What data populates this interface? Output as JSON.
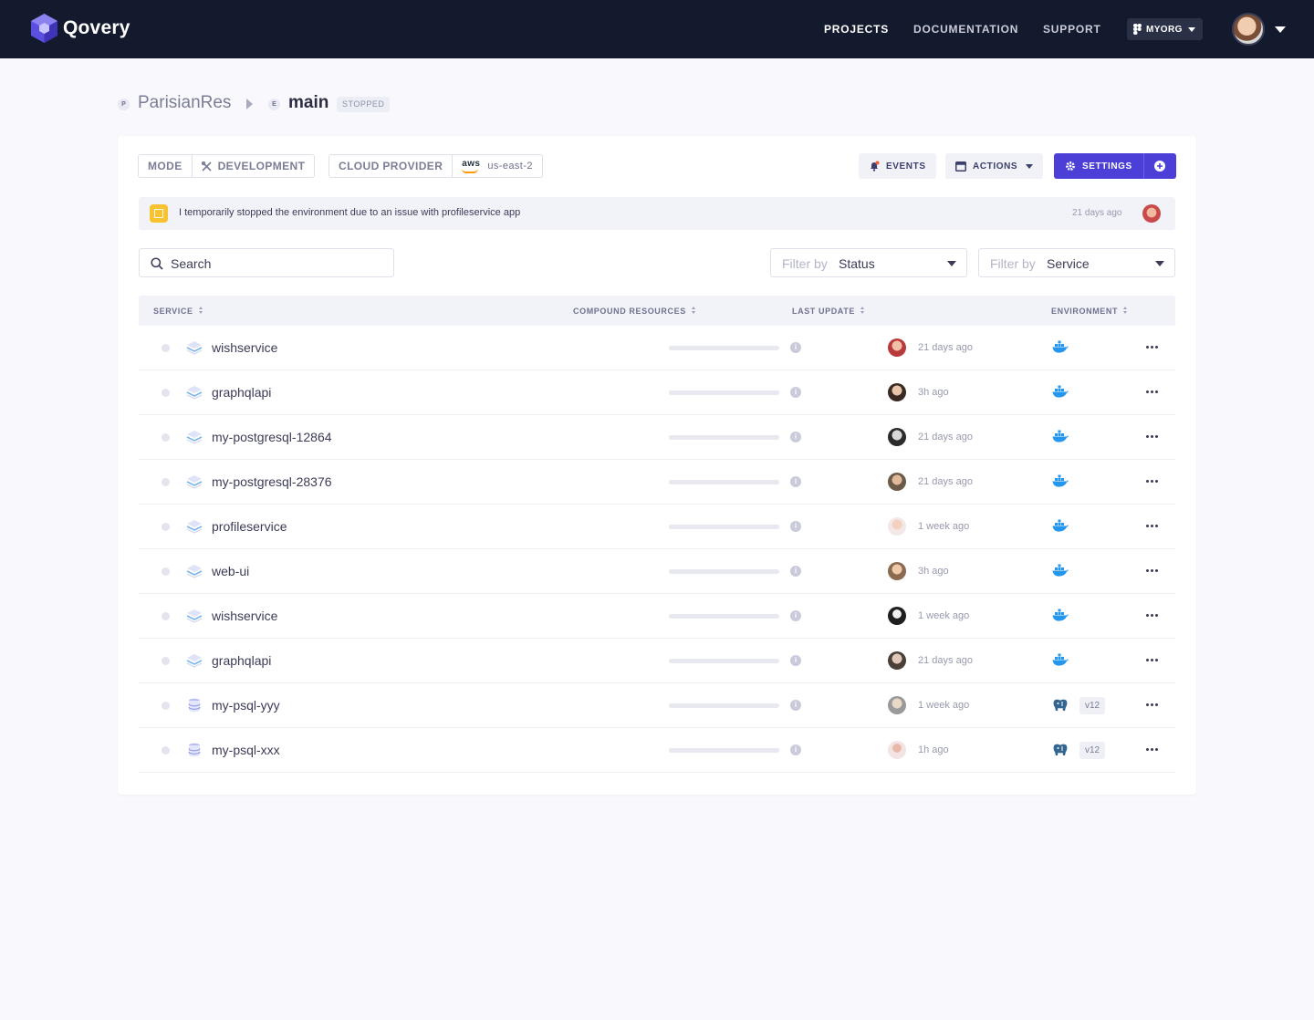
{
  "nav": {
    "brand": "Qovery",
    "links": [
      "PROJECTS",
      "DOCUMENTATION",
      "SUPPORT"
    ],
    "org": "MYORG"
  },
  "breadcrumb": {
    "project_badge": "P",
    "project": "ParisianRes",
    "env_badge": "E",
    "environment": "main",
    "status": "STOPPED"
  },
  "toolbar": {
    "mode_label": "MODE",
    "mode_value": "DEVELOPMENT",
    "provider_label": "CLOUD PROVIDER",
    "provider_logo": "aws",
    "region": "us-east-2",
    "events": "EVENTS",
    "actions": "ACTIONS",
    "settings": "SETTINGS"
  },
  "notice": {
    "text": "I temporarily stopped the environment due to an issue with profileservice app",
    "time": "21 days ago"
  },
  "search": {
    "value": "Search"
  },
  "filters": [
    {
      "label": "Filter by",
      "value": "Status"
    },
    {
      "label": "Filter by",
      "value": "Service"
    }
  ],
  "table": {
    "headers": [
      "SERVICE",
      "COMPOUND RESOURCES",
      "LAST UPDATE",
      "ENVIRONMENT"
    ],
    "rows": [
      {
        "name": "wishservice",
        "kind": "app",
        "updated": "21 days ago",
        "env": "docker",
        "version": ""
      },
      {
        "name": "graphqlapi",
        "kind": "app",
        "updated": "3h ago",
        "env": "docker",
        "version": ""
      },
      {
        "name": "my-postgresql-12864",
        "kind": "app",
        "updated": "21 days ago",
        "env": "docker",
        "version": ""
      },
      {
        "name": "my-postgresql-28376",
        "kind": "app",
        "updated": "21 days ago",
        "env": "docker",
        "version": ""
      },
      {
        "name": "profileservice",
        "kind": "app",
        "updated": "1 week ago",
        "env": "docker",
        "version": ""
      },
      {
        "name": "web-ui",
        "kind": "app",
        "updated": "3h ago",
        "env": "docker",
        "version": ""
      },
      {
        "name": "wishservice",
        "kind": "app",
        "updated": "1 week ago",
        "env": "docker",
        "version": ""
      },
      {
        "name": "graphqlapi",
        "kind": "app",
        "updated": "21 days ago",
        "env": "docker",
        "version": ""
      },
      {
        "name": "my-psql-yyy",
        "kind": "database",
        "updated": "1 week ago",
        "env": "postgresql",
        "version": "v12"
      },
      {
        "name": "my-psql-xxx",
        "kind": "database",
        "updated": "1h ago",
        "env": "postgresql",
        "version": "v12"
      }
    ]
  },
  "colors": {
    "nav_bg": "#141a2e",
    "primary": "#4b3fd8",
    "notice_icon": "#f8c231",
    "docker": "#2496ed"
  }
}
